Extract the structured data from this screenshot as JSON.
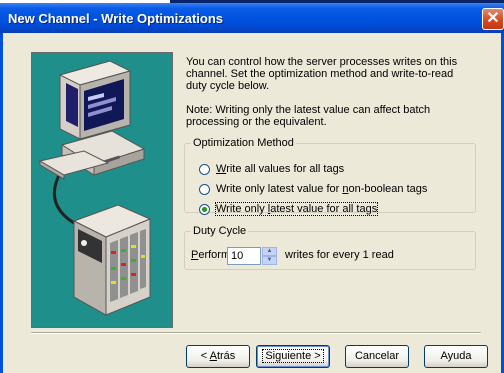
{
  "window": {
    "title": "New Channel - Write Optimizations",
    "close_glyph": "✕"
  },
  "description": {
    "para1": "You can control how the server processes writes on this channel.  Set the optimization method and write-to-read duty cycle below.",
    "para2": "Note:  Writing only the latest value can affect batch processing or the equivalent."
  },
  "optimization": {
    "legend": "Optimization Method",
    "options": [
      {
        "pre": "",
        "key": "W",
        "post": "rite all values for all tags"
      },
      {
        "pre": "Write only latest value for ",
        "key": "n",
        "post": "on-boolean tags"
      },
      {
        "pre": "Write only ",
        "key": "l",
        "post": "atest value for all tags"
      }
    ],
    "selected_index": 2
  },
  "duty_cycle": {
    "legend": "Duty Cycle",
    "perform_key": "P",
    "perform_rest": "erform",
    "value": "10",
    "suffix": "writes for every 1 read"
  },
  "buttons": {
    "back": {
      "pre": "< ",
      "key": "A",
      "post": "trás"
    },
    "next": {
      "text": "Siguiente >"
    },
    "cancel": "Cancelar",
    "help": "Ayuda"
  },
  "illustration": {
    "icons": [
      "computer-icon",
      "device-rack-icon"
    ]
  }
}
